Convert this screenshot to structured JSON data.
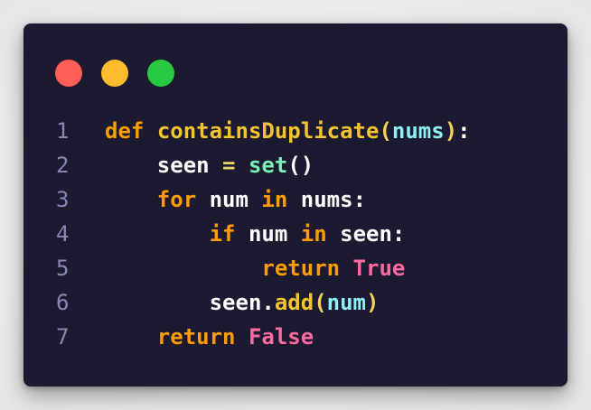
{
  "window_controls": [
    {
      "name": "close",
      "color": "#ff5f57"
    },
    {
      "name": "minimize",
      "color": "#febc2e"
    },
    {
      "name": "maximize",
      "color": "#28c840"
    }
  ],
  "palette": {
    "keyword": "#ff9d00",
    "function": "#f4c430",
    "paren": "#f2d25e",
    "param": "#8ef0f2",
    "identifier": "#ffffff",
    "operator": "#f2d25e",
    "builtin": "#7cf2b2",
    "boolean": "#ff6aa0",
    "punct": "#ffffff",
    "line_number": "#8a86b3"
  },
  "code": {
    "language": "python",
    "lines": [
      {
        "number": "1",
        "tokens": [
          {
            "text": "def",
            "kind": "keyword"
          },
          {
            "text": " ",
            "kind": "space"
          },
          {
            "text": "containsDuplicate",
            "kind": "function"
          },
          {
            "text": "(",
            "kind": "paren"
          },
          {
            "text": "nums",
            "kind": "param"
          },
          {
            "text": ")",
            "kind": "paren"
          },
          {
            "text": ":",
            "kind": "punct"
          }
        ]
      },
      {
        "number": "2",
        "tokens": [
          {
            "text": "    ",
            "kind": "space"
          },
          {
            "text": "seen",
            "kind": "identifier"
          },
          {
            "text": " ",
            "kind": "space"
          },
          {
            "text": "=",
            "kind": "operator"
          },
          {
            "text": " ",
            "kind": "space"
          },
          {
            "text": "set",
            "kind": "builtin"
          },
          {
            "text": "()",
            "kind": "punct"
          }
        ]
      },
      {
        "number": "3",
        "tokens": [
          {
            "text": "    ",
            "kind": "space"
          },
          {
            "text": "for",
            "kind": "keyword"
          },
          {
            "text": " ",
            "kind": "space"
          },
          {
            "text": "num",
            "kind": "identifier"
          },
          {
            "text": " ",
            "kind": "space"
          },
          {
            "text": "in",
            "kind": "keyword"
          },
          {
            "text": " ",
            "kind": "space"
          },
          {
            "text": "nums",
            "kind": "identifier"
          },
          {
            "text": ":",
            "kind": "punct"
          }
        ]
      },
      {
        "number": "4",
        "tokens": [
          {
            "text": "        ",
            "kind": "space"
          },
          {
            "text": "if",
            "kind": "keyword"
          },
          {
            "text": " ",
            "kind": "space"
          },
          {
            "text": "num",
            "kind": "identifier"
          },
          {
            "text": " ",
            "kind": "space"
          },
          {
            "text": "in",
            "kind": "keyword"
          },
          {
            "text": " ",
            "kind": "space"
          },
          {
            "text": "seen",
            "kind": "identifier"
          },
          {
            "text": ":",
            "kind": "punct"
          }
        ]
      },
      {
        "number": "5",
        "tokens": [
          {
            "text": "            ",
            "kind": "space"
          },
          {
            "text": "return",
            "kind": "keyword"
          },
          {
            "text": " ",
            "kind": "space"
          },
          {
            "text": "True",
            "kind": "boolean"
          }
        ]
      },
      {
        "number": "6",
        "tokens": [
          {
            "text": "        ",
            "kind": "space"
          },
          {
            "text": "seen",
            "kind": "identifier"
          },
          {
            "text": ".",
            "kind": "punct"
          },
          {
            "text": "add",
            "kind": "function"
          },
          {
            "text": "(",
            "kind": "paren"
          },
          {
            "text": "num",
            "kind": "param"
          },
          {
            "text": ")",
            "kind": "paren"
          }
        ]
      },
      {
        "number": "7",
        "tokens": [
          {
            "text": "    ",
            "kind": "space"
          },
          {
            "text": "return",
            "kind": "keyword"
          },
          {
            "text": " ",
            "kind": "space"
          },
          {
            "text": "False",
            "kind": "boolean"
          }
        ]
      }
    ]
  }
}
